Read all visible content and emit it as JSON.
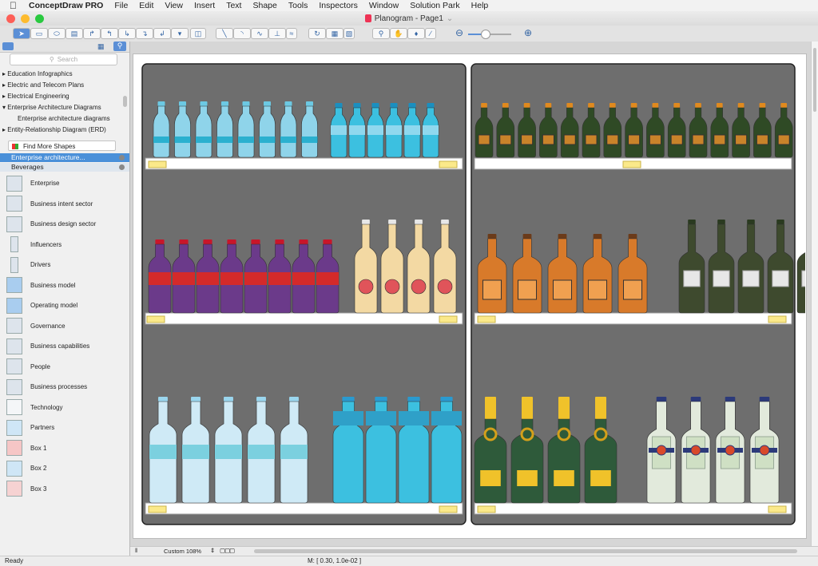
{
  "menu": {
    "app_name": "ConceptDraw PRO",
    "items": [
      "File",
      "Edit",
      "View",
      "Insert",
      "Text",
      "Shape",
      "Tools",
      "Inspectors",
      "Window",
      "Solution Park",
      "Help"
    ]
  },
  "window": {
    "title": "Planogram - Page1"
  },
  "sidebar": {
    "search_placeholder": "Search",
    "libraries": [
      {
        "label": "Education Infographics",
        "sub": false
      },
      {
        "label": "Electric and Telecom Plans",
        "sub": false
      },
      {
        "label": "Electrical Engineering",
        "sub": false
      },
      {
        "label": "Enterprise Architecture Diagrams",
        "sub": false
      },
      {
        "label": "Enterprise architecture diagrams",
        "sub": true
      },
      {
        "label": "Entity-Relationship Diagram (ERD)",
        "sub": false
      }
    ],
    "find_more": "Find More Shapes",
    "active_library": "Enterprise architecture...",
    "second_library": "Beverages",
    "shapes": [
      "Enterprise",
      "Business intent sector",
      "Business design sector",
      "Influencers",
      "Drivers",
      "Business model",
      "Operating model",
      "Governance",
      "Business capabilities",
      "People",
      "Business processes",
      "Technology",
      "Partners",
      "Box 1",
      "Box 2",
      "Box 3"
    ]
  },
  "bottom": {
    "zoom": "Custom 108%"
  },
  "status": {
    "ready": "Ready",
    "coords": "M: [ 0.30, 1.0e-02 ]"
  },
  "colors": {
    "shelf_bg": "#6e6e6e",
    "water_light": "#8fd4ea",
    "water_cyan": "#3cc0e0",
    "soda": "#6b3a8a",
    "soda_band": "#d42a2a",
    "juice": "#f3d9a3",
    "beer": "#2f4a25",
    "beer_cap": "#e08a1e",
    "whiskey": "#d87a2a",
    "wine": "#3e4a2e",
    "champagne": "#2e5a3a",
    "champagne_foil": "#f0c22a",
    "vermouth": "#e2eadc",
    "price_tag": "#fbe98a"
  }
}
